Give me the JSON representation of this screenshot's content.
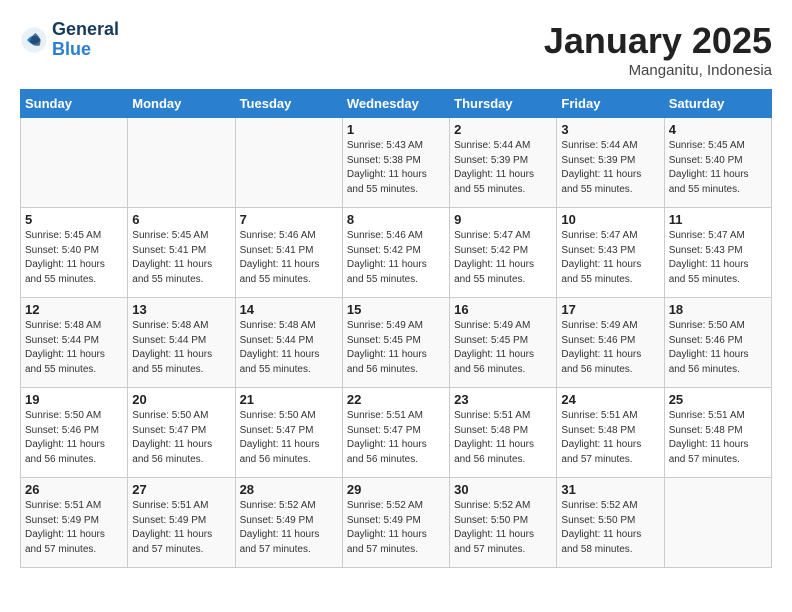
{
  "header": {
    "logo_line1": "General",
    "logo_line2": "Blue",
    "title": "January 2025",
    "subtitle": "Manganitu, Indonesia"
  },
  "weekdays": [
    "Sunday",
    "Monday",
    "Tuesday",
    "Wednesday",
    "Thursday",
    "Friday",
    "Saturday"
  ],
  "weeks": [
    [
      {
        "day": "",
        "info": ""
      },
      {
        "day": "",
        "info": ""
      },
      {
        "day": "",
        "info": ""
      },
      {
        "day": "1",
        "info": "Sunrise: 5:43 AM\nSunset: 5:38 PM\nDaylight: 11 hours\nand 55 minutes."
      },
      {
        "day": "2",
        "info": "Sunrise: 5:44 AM\nSunset: 5:39 PM\nDaylight: 11 hours\nand 55 minutes."
      },
      {
        "day": "3",
        "info": "Sunrise: 5:44 AM\nSunset: 5:39 PM\nDaylight: 11 hours\nand 55 minutes."
      },
      {
        "day": "4",
        "info": "Sunrise: 5:45 AM\nSunset: 5:40 PM\nDaylight: 11 hours\nand 55 minutes."
      }
    ],
    [
      {
        "day": "5",
        "info": "Sunrise: 5:45 AM\nSunset: 5:40 PM\nDaylight: 11 hours\nand 55 minutes."
      },
      {
        "day": "6",
        "info": "Sunrise: 5:45 AM\nSunset: 5:41 PM\nDaylight: 11 hours\nand 55 minutes."
      },
      {
        "day": "7",
        "info": "Sunrise: 5:46 AM\nSunset: 5:41 PM\nDaylight: 11 hours\nand 55 minutes."
      },
      {
        "day": "8",
        "info": "Sunrise: 5:46 AM\nSunset: 5:42 PM\nDaylight: 11 hours\nand 55 minutes."
      },
      {
        "day": "9",
        "info": "Sunrise: 5:47 AM\nSunset: 5:42 PM\nDaylight: 11 hours\nand 55 minutes."
      },
      {
        "day": "10",
        "info": "Sunrise: 5:47 AM\nSunset: 5:43 PM\nDaylight: 11 hours\nand 55 minutes."
      },
      {
        "day": "11",
        "info": "Sunrise: 5:47 AM\nSunset: 5:43 PM\nDaylight: 11 hours\nand 55 minutes."
      }
    ],
    [
      {
        "day": "12",
        "info": "Sunrise: 5:48 AM\nSunset: 5:44 PM\nDaylight: 11 hours\nand 55 minutes."
      },
      {
        "day": "13",
        "info": "Sunrise: 5:48 AM\nSunset: 5:44 PM\nDaylight: 11 hours\nand 55 minutes."
      },
      {
        "day": "14",
        "info": "Sunrise: 5:48 AM\nSunset: 5:44 PM\nDaylight: 11 hours\nand 55 minutes."
      },
      {
        "day": "15",
        "info": "Sunrise: 5:49 AM\nSunset: 5:45 PM\nDaylight: 11 hours\nand 56 minutes."
      },
      {
        "day": "16",
        "info": "Sunrise: 5:49 AM\nSunset: 5:45 PM\nDaylight: 11 hours\nand 56 minutes."
      },
      {
        "day": "17",
        "info": "Sunrise: 5:49 AM\nSunset: 5:46 PM\nDaylight: 11 hours\nand 56 minutes."
      },
      {
        "day": "18",
        "info": "Sunrise: 5:50 AM\nSunset: 5:46 PM\nDaylight: 11 hours\nand 56 minutes."
      }
    ],
    [
      {
        "day": "19",
        "info": "Sunrise: 5:50 AM\nSunset: 5:46 PM\nDaylight: 11 hours\nand 56 minutes."
      },
      {
        "day": "20",
        "info": "Sunrise: 5:50 AM\nSunset: 5:47 PM\nDaylight: 11 hours\nand 56 minutes."
      },
      {
        "day": "21",
        "info": "Sunrise: 5:50 AM\nSunset: 5:47 PM\nDaylight: 11 hours\nand 56 minutes."
      },
      {
        "day": "22",
        "info": "Sunrise: 5:51 AM\nSunset: 5:47 PM\nDaylight: 11 hours\nand 56 minutes."
      },
      {
        "day": "23",
        "info": "Sunrise: 5:51 AM\nSunset: 5:48 PM\nDaylight: 11 hours\nand 56 minutes."
      },
      {
        "day": "24",
        "info": "Sunrise: 5:51 AM\nSunset: 5:48 PM\nDaylight: 11 hours\nand 57 minutes."
      },
      {
        "day": "25",
        "info": "Sunrise: 5:51 AM\nSunset: 5:48 PM\nDaylight: 11 hours\nand 57 minutes."
      }
    ],
    [
      {
        "day": "26",
        "info": "Sunrise: 5:51 AM\nSunset: 5:49 PM\nDaylight: 11 hours\nand 57 minutes."
      },
      {
        "day": "27",
        "info": "Sunrise: 5:51 AM\nSunset: 5:49 PM\nDaylight: 11 hours\nand 57 minutes."
      },
      {
        "day": "28",
        "info": "Sunrise: 5:52 AM\nSunset: 5:49 PM\nDaylight: 11 hours\nand 57 minutes."
      },
      {
        "day": "29",
        "info": "Sunrise: 5:52 AM\nSunset: 5:49 PM\nDaylight: 11 hours\nand 57 minutes."
      },
      {
        "day": "30",
        "info": "Sunrise: 5:52 AM\nSunset: 5:50 PM\nDaylight: 11 hours\nand 57 minutes."
      },
      {
        "day": "31",
        "info": "Sunrise: 5:52 AM\nSunset: 5:50 PM\nDaylight: 11 hours\nand 58 minutes."
      },
      {
        "day": "",
        "info": ""
      }
    ]
  ]
}
